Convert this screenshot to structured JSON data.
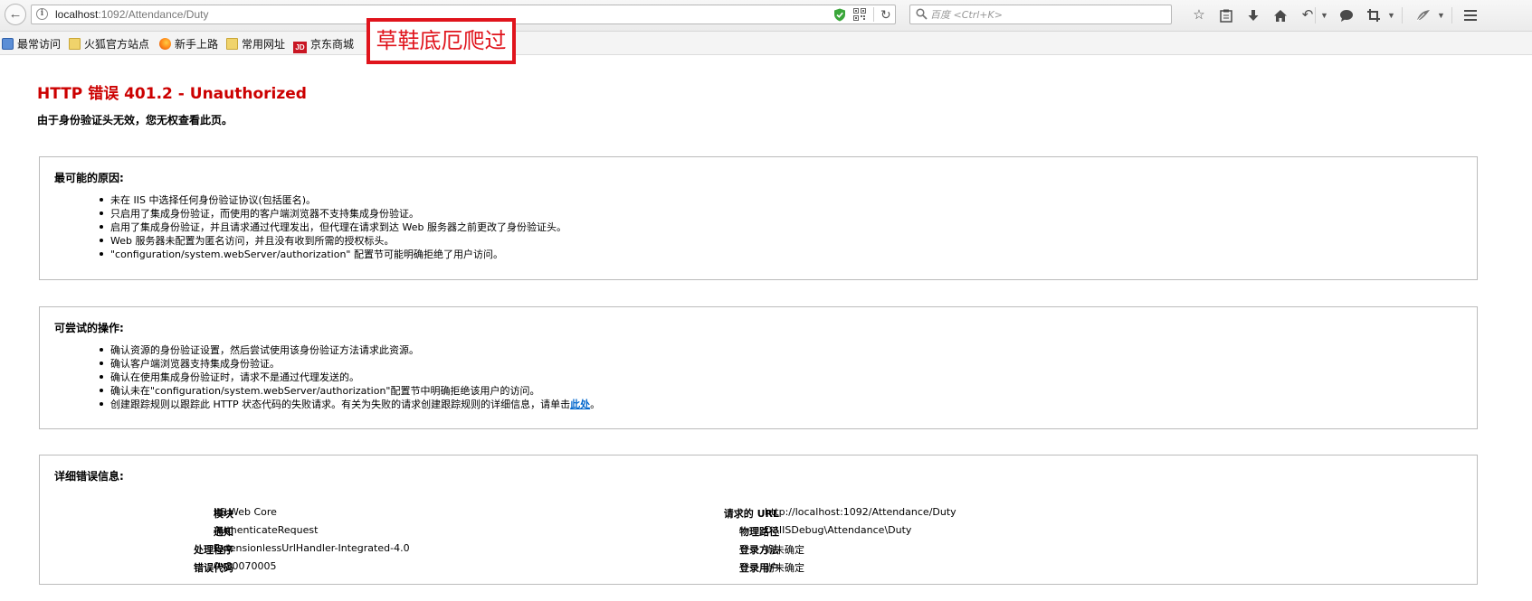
{
  "browser": {
    "url_host": "localhost",
    "url_path": ":1092/Attendance/Duty",
    "search_placeholder": "百度 <Ctrl+K>"
  },
  "bookmarks": [
    {
      "label": "最常访问",
      "icon": "recent-icon"
    },
    {
      "label": "火狐官方站点",
      "icon": "folder-icon"
    },
    {
      "label": "新手上路",
      "icon": "firefox-icon"
    },
    {
      "label": "常用网址",
      "icon": "folder-icon"
    },
    {
      "label": "京东商城",
      "icon": "jd-icon",
      "icon_text": "JD"
    }
  ],
  "annotation": "草鞋底厄爬过",
  "page": {
    "title": "HTTP 错误 401.2 - Unauthorized",
    "subtitle": "由于身份验证头无效，您无权查看此页。"
  },
  "causes": {
    "heading": "最可能的原因:",
    "items": [
      "未在 IIS 中选择任何身份验证协议(包括匿名)。",
      "只启用了集成身份验证，而使用的客户端浏览器不支持集成身份验证。",
      "启用了集成身份验证，并且请求通过代理发出，但代理在请求到达 Web 服务器之前更改了身份验证头。",
      "Web 服务器未配置为匿名访问，并且没有收到所需的授权标头。",
      "\"configuration/system.webServer/authorization\" 配置节可能明确拒绝了用户访问。"
    ]
  },
  "actions": {
    "heading": "可尝试的操作:",
    "items": [
      "确认资源的身份验证设置，然后尝试使用该身份验证方法请求此资源。",
      "确认客户端浏览器支持集成身份验证。",
      "确认在使用集成身份验证时，请求不是通过代理发送的。",
      "确认未在\"configuration/system.webServer/authorization\"配置节中明确拒绝该用户的访问。"
    ],
    "last_item_text": "创建跟踪规则以跟踪此 HTTP 状态代码的失败请求。有关为失败的请求创建跟踪规则的详细信息，请单击",
    "link_label": "此处",
    "last_item_suffix": "。"
  },
  "details": {
    "heading": "详细错误信息:",
    "left": [
      {
        "label": "模块",
        "value": "IIS Web Core"
      },
      {
        "label": "通知",
        "value": "AuthenticateRequest"
      },
      {
        "label": "处理程序",
        "value": "ExtensionlessUrlHandler-Integrated-4.0"
      },
      {
        "label": "错误代码",
        "value": "0x80070005"
      }
    ],
    "right": [
      {
        "label": "请求的 URL",
        "value": "http://localhost:1092/Attendance/Duty"
      },
      {
        "label": "物理路径",
        "value": "D:\\IISDebug\\Attendance\\Duty"
      },
      {
        "label": "登录方法",
        "value": "尚未确定"
      },
      {
        "label": "登录用户",
        "value": "尚未确定"
      }
    ]
  }
}
